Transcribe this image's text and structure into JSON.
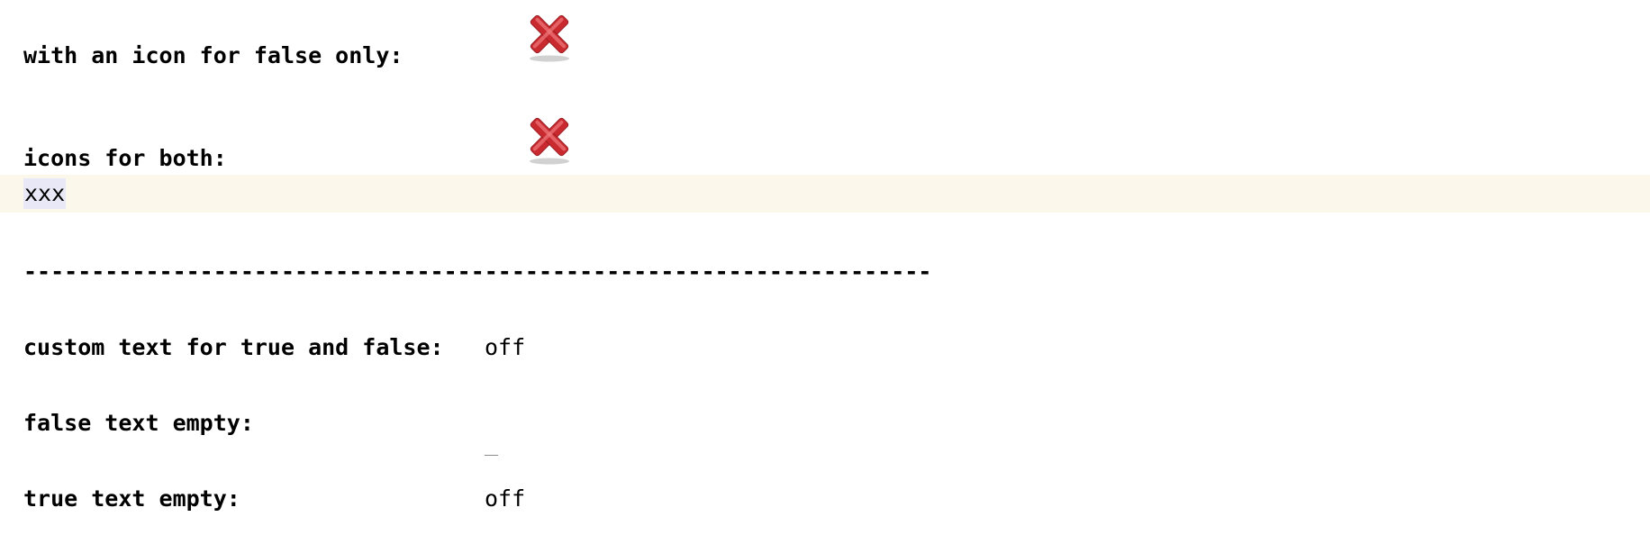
{
  "rows": {
    "false_only": {
      "label": "with an icon for false only:",
      "icon": "red-x-icon"
    },
    "both": {
      "label": "icons for both:",
      "icon": "red-x-icon"
    },
    "selected": {
      "text": "xxx"
    },
    "separator": {
      "text": "-------------------------------------------------------------------"
    },
    "custom_text": {
      "label": "custom text for true and false:",
      "value": "off"
    },
    "false_empty": {
      "label": "false text empty:",
      "value": "_"
    },
    "true_empty": {
      "label": "true text empty:",
      "value": "off"
    }
  },
  "colors": {
    "icon_red": "#d8373b",
    "row_highlight": "#fbf8eb",
    "selection": "#e9e8f6"
  }
}
